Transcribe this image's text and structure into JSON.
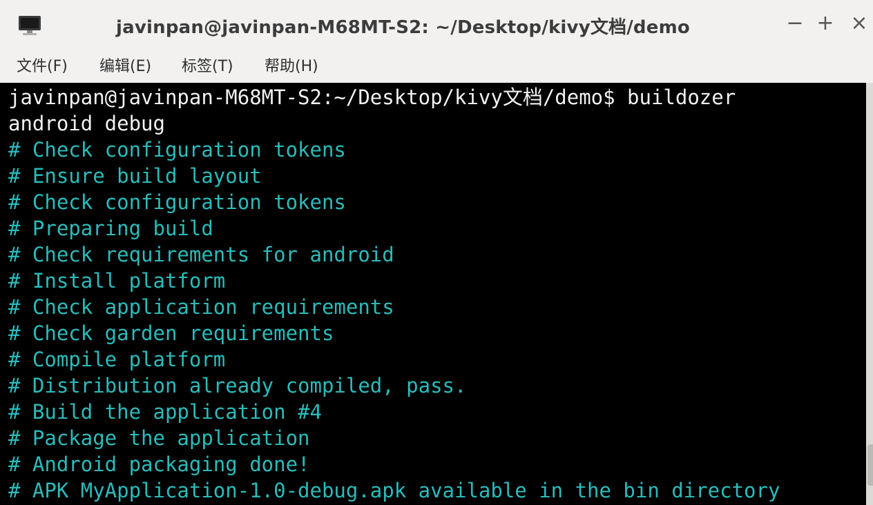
{
  "window": {
    "title": "javinpan@javinpan-M68MT-S2: ~/Desktop/kivy文档/demo",
    "icon": "terminal-monitor-icon",
    "controls": {
      "minimize": "−",
      "maximize": "+",
      "close": "×"
    }
  },
  "menu": {
    "items": [
      {
        "label": "文件(F)"
      },
      {
        "label": "编辑(E)"
      },
      {
        "label": "标签(T)"
      },
      {
        "label": "帮助(H)"
      }
    ]
  },
  "terminal": {
    "prompt_line": "javinpan@javinpan-M68MT-S2:~/Desktop/kivy文档/demo$ buildozer",
    "command_wrap": "android debug",
    "output": [
      "# Check configuration tokens",
      "# Ensure build layout",
      "# Check configuration tokens",
      "# Preparing build",
      "# Check requirements for android",
      "# Install platform",
      "# Check application requirements",
      "# Check garden requirements",
      "# Compile platform",
      "# Distribution already compiled, pass.",
      "# Build the application #4",
      "# Package the application",
      "# Android packaging done!",
      "# APK MyApplication-1.0-debug.apk available in the bin directory"
    ]
  },
  "colors": {
    "terminal_bg": "#000000",
    "prompt_text": "#f2f2f2",
    "output_text": "#2bbbbb",
    "chrome_bg": "#f2f1f0"
  }
}
